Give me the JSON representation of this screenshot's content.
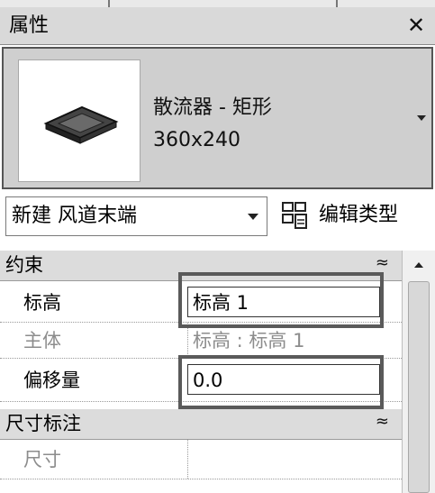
{
  "panel": {
    "title": "属性",
    "close_glyph": "✕"
  },
  "type_selector": {
    "family_name": "散流器 - 矩形",
    "type_size": "360x240"
  },
  "instance_filter": {
    "label": "新建 风道末端"
  },
  "edit_type": {
    "label": "编辑类型"
  },
  "sections": [
    {
      "title": "约束",
      "collapse_glyph": "≈",
      "rows": [
        {
          "name": "标高",
          "value": "标高 1"
        },
        {
          "name": "主体",
          "value": "标高 : 标高 1"
        },
        {
          "name": "偏移量",
          "value": "0.0"
        }
      ]
    },
    {
      "title": "尺寸标注",
      "collapse_glyph": "≈",
      "rows": [
        {
          "name": "尺寸",
          "value": ""
        }
      ]
    }
  ],
  "icons": {
    "close": "close-icon",
    "preview": "diffuser-preview-icon",
    "dropdown": "chevron-down-icon",
    "edit_type": "edit-type-icon",
    "collapse": "collapse-icon",
    "scroll_up": "scroll-up-arrow-icon"
  }
}
